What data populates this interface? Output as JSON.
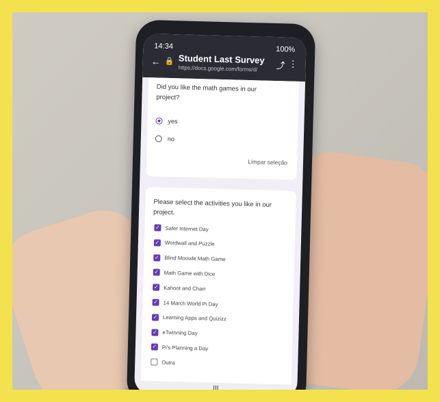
{
  "status": {
    "time": "14:34",
    "battery": "100%"
  },
  "appbar": {
    "title": "Student Last Survey",
    "url": "https://docs.google.com/forms/d/",
    "back_icon": "arrow-left-icon",
    "lock_icon": "lock-icon",
    "share_icon": "share-icon",
    "more_icon": "more-vert-icon"
  },
  "question1": {
    "text": "Did you like the math games in our project?",
    "options": [
      "yes",
      "no"
    ],
    "selected": "yes",
    "clear_label": "Limpar seleção"
  },
  "question2": {
    "text": "Please select the activities you like in our project.",
    "options": [
      {
        "label": "Safer Internet Day",
        "checked": true
      },
      {
        "label": "Wordwall and Puzzle",
        "checked": true
      },
      {
        "label": "Blind Moowle Math Game",
        "checked": true
      },
      {
        "label": "Math Game with Dice",
        "checked": true
      },
      {
        "label": "Kahoot and Charr",
        "checked": true
      },
      {
        "label": "14 March World Pi Day",
        "checked": true
      },
      {
        "label": "Learning Apps and Quizizz",
        "checked": true
      },
      {
        "label": "eTwinning Day",
        "checked": true
      },
      {
        "label": "Pi's Planning a Day",
        "checked": true
      },
      {
        "label": "Outra",
        "checked": false
      }
    ]
  },
  "colors": {
    "accent": "#673ab7",
    "background": "#f3e24d"
  }
}
